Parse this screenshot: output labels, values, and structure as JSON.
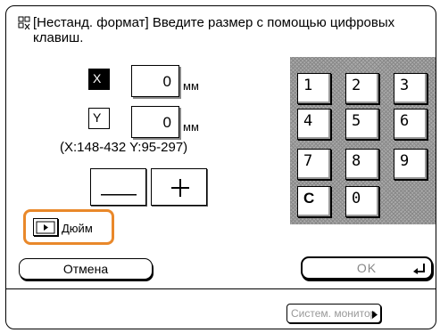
{
  "message": {
    "text": "[Нестанд. формат] Введите размер с помощью цифровых клавиш.",
    "icon": "multifunction-icon"
  },
  "x_field": {
    "label": "X",
    "value": "0",
    "unit": "мм"
  },
  "y_field": {
    "label": "Y",
    "value": "0",
    "unit": "мм"
  },
  "range_text": "(X:148-432 Y:95-297)",
  "minus_label": "—",
  "plus_label": "+",
  "keypad": {
    "keys": [
      "1",
      "2",
      "3",
      "4",
      "5",
      "6",
      "7",
      "8",
      "9",
      "C",
      "0"
    ]
  },
  "inch_toggle": {
    "label": "Дюйм"
  },
  "cancel_button": "Отмена",
  "ok_button": "OK",
  "system_monitor": "Систем. монитор",
  "colors": {
    "highlight": "#e9882a",
    "keypad_bg": "#aaaaaa"
  }
}
